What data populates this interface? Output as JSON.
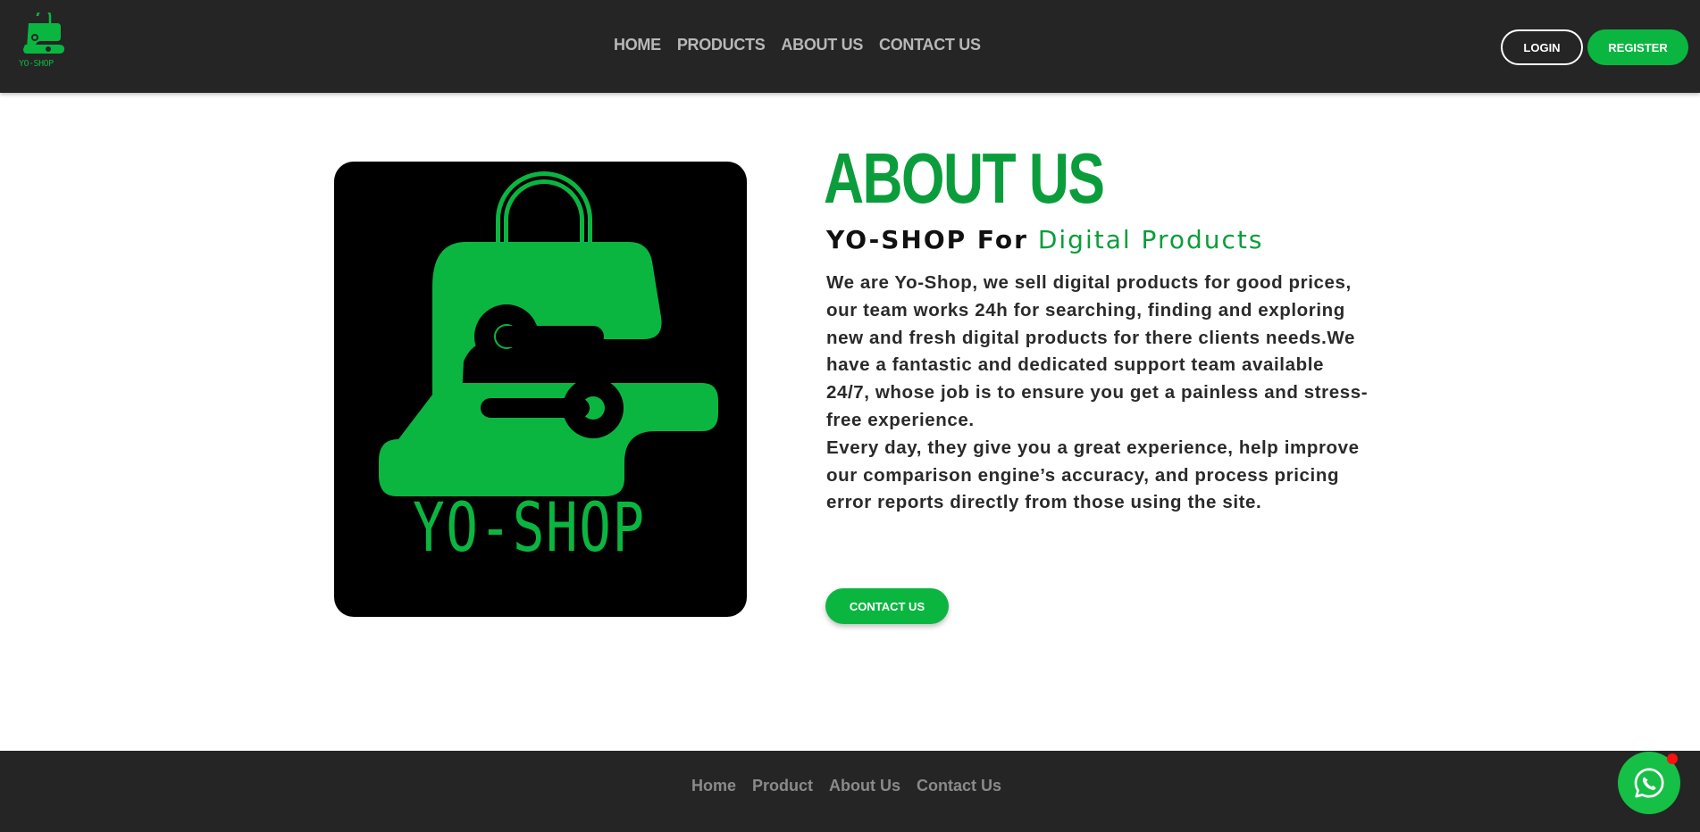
{
  "header": {
    "logo_text": "YO-SHOP",
    "nav": [
      {
        "label": "HOME"
      },
      {
        "label": "PRODUCTS"
      },
      {
        "label": "ABOUT US"
      },
      {
        "label": "CONTACT US"
      }
    ],
    "login_label": "LOGIN",
    "register_label": "REGISTER"
  },
  "about": {
    "image_logo_text": "YO-SHOP",
    "title": "ABOUT US",
    "subtitle_part1": "YO-SHOP For",
    "subtitle_part2": "Digital Products",
    "paragraph1": "We are Yo-Shop, we sell digital products for good prices, our team works 24h for searching, finding and exploring new and fresh digital products for there clients needs.We have a fantastic and dedicated support team available 24/7, whose job is to ensure you get a painless and stress-free experience.",
    "paragraph2": "Every day, they give you a great experience, help improve our comparison engine’s accuracy, and process pricing error reports directly from those using the site.",
    "contact_button": "CONTACT US"
  },
  "footer": {
    "nav": [
      {
        "label": "Home"
      },
      {
        "label": "Product"
      },
      {
        "label": "About Us"
      },
      {
        "label": "Contact Us"
      }
    ]
  },
  "colors": {
    "brand_green": "#0bb640",
    "title_green": "#0b9d3b",
    "header_bg": "#252525",
    "notification_red": "#ff1010"
  },
  "icons": {
    "chat": "whatsapp-icon"
  }
}
